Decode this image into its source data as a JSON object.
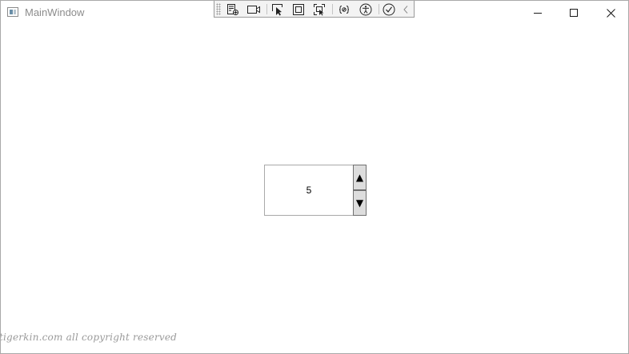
{
  "window": {
    "title": "MainWindow",
    "icon": "app-window-icon"
  },
  "caption_buttons": {
    "minimize": "minimize-icon",
    "maximize": "maximize-icon",
    "close": "close-icon"
  },
  "dev_toolbar": {
    "items": [
      "live-visual-tree-icon",
      "video-camera-icon",
      "select-element-icon",
      "display-layout-adorners-icon",
      "track-focused-element-icon",
      "binding-failures-icon",
      "accessibility-icon",
      "checkmark-icon",
      "collapse-chevron-icon"
    ]
  },
  "spinner": {
    "value": "5",
    "up_glyph": "▲",
    "down_glyph": "▼"
  },
  "watermark": {
    "text": "tigerkin.com all copyright reserved"
  },
  "colors": {
    "title_text": "#8c8c8c",
    "border": "#a9a9a9",
    "spin_button_bg": "#dddddd"
  }
}
